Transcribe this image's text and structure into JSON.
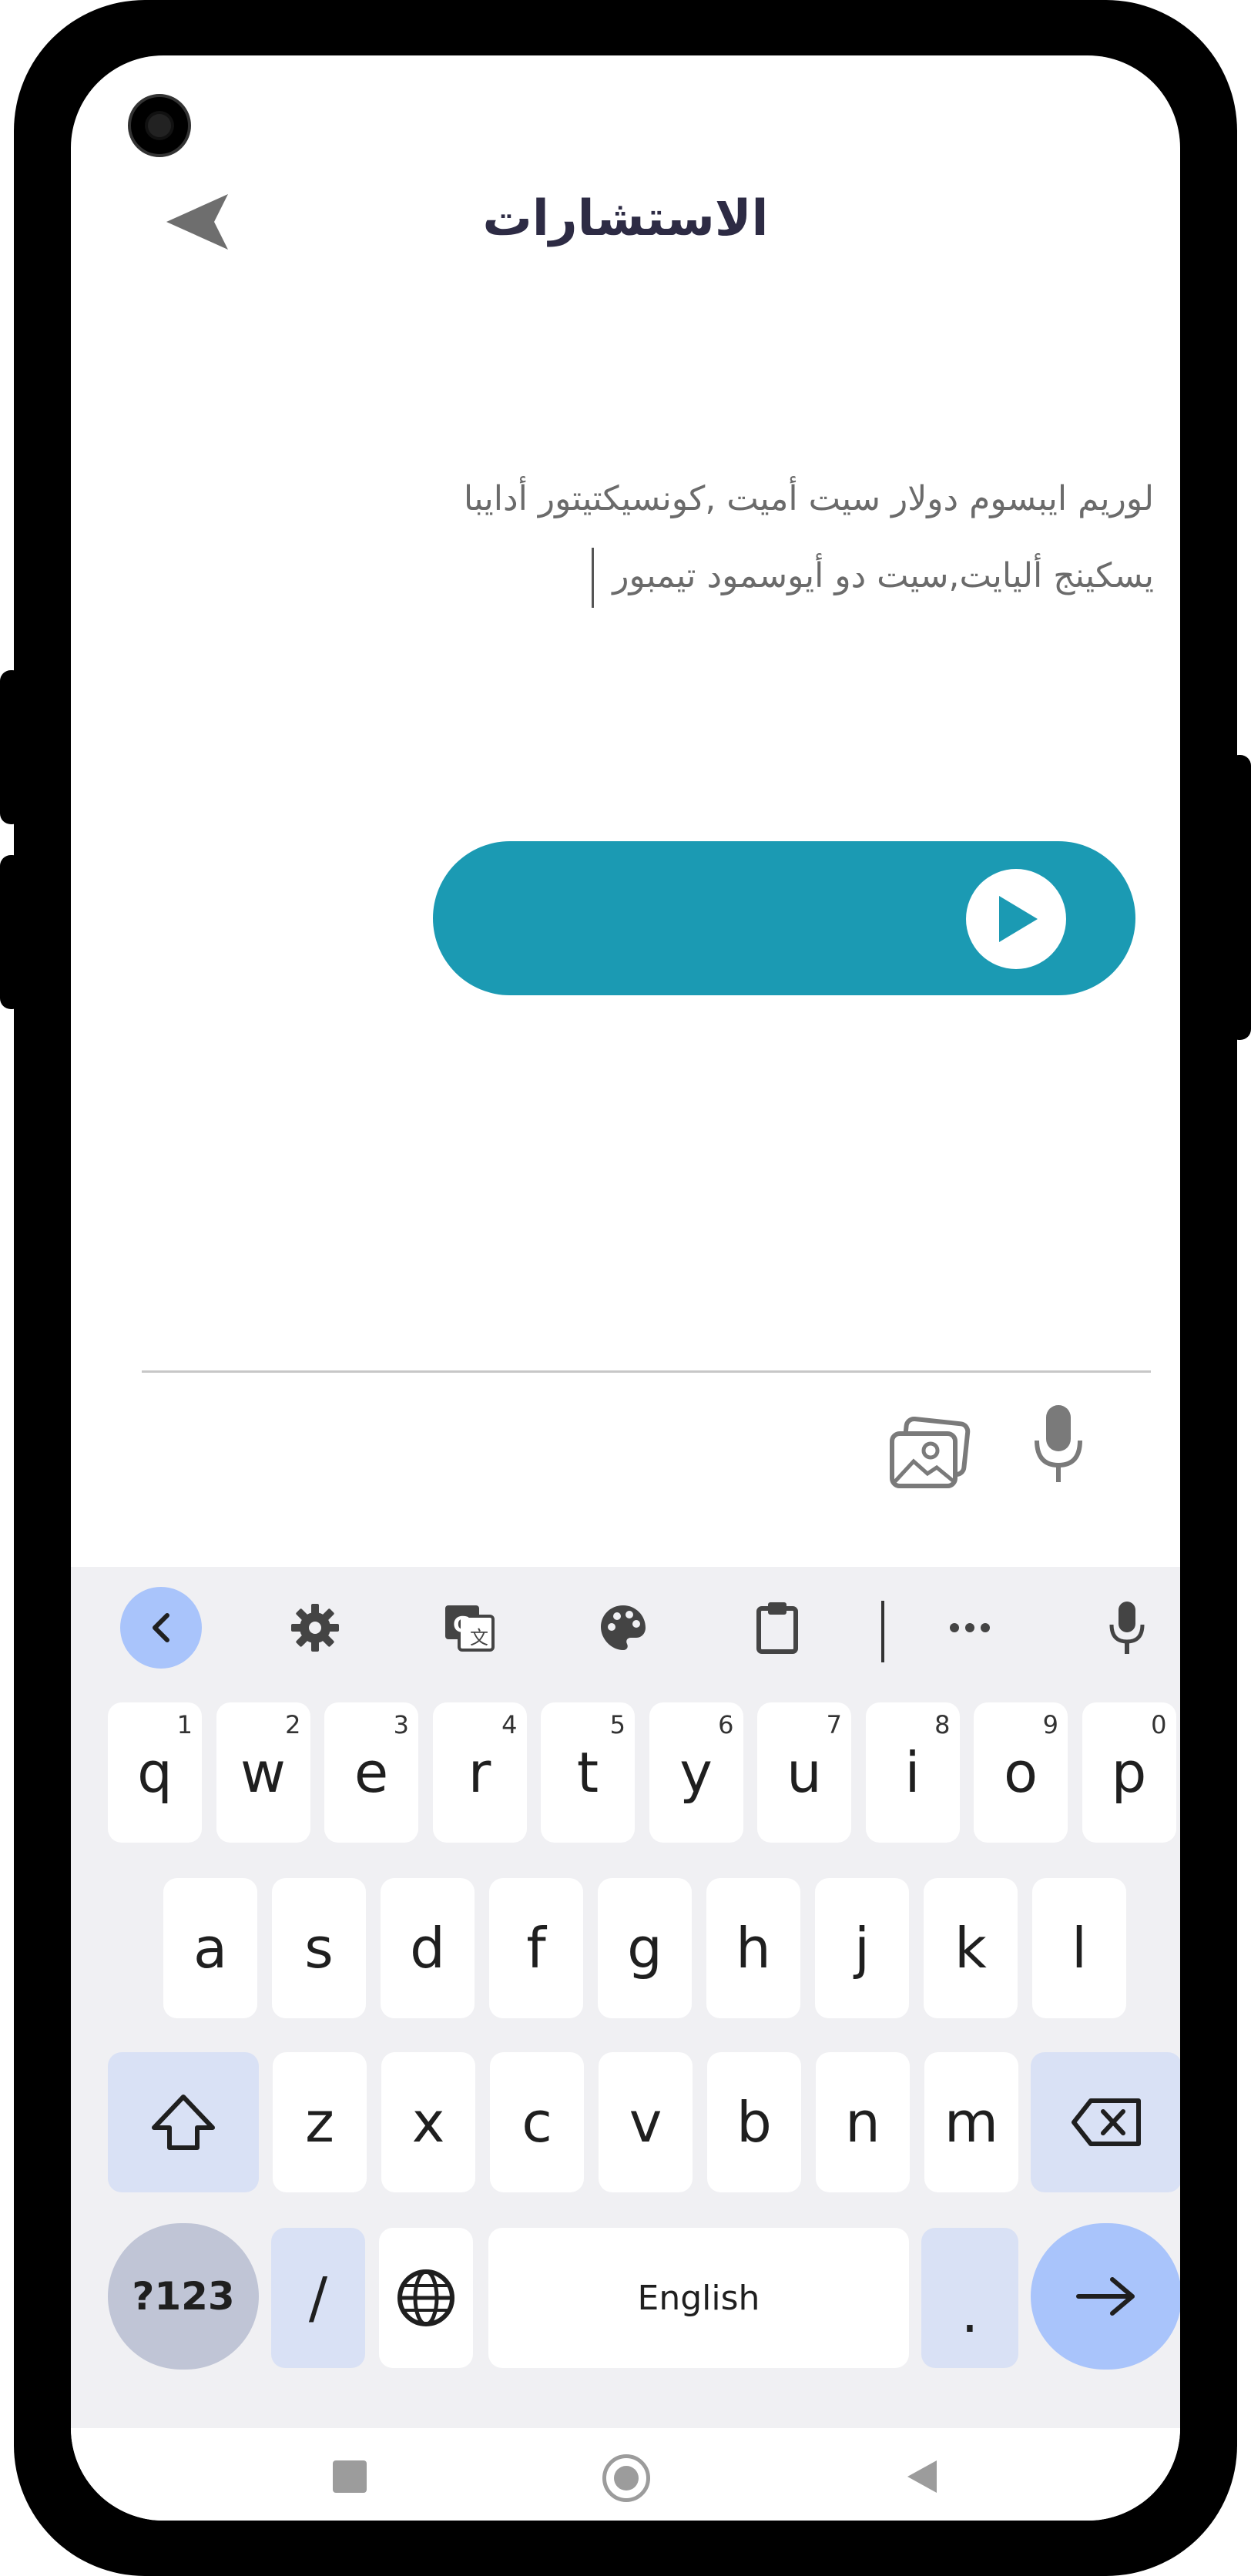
{
  "header": {
    "title": "الاستشارات"
  },
  "message": {
    "line1": "لوريم ايبسوم دولار سيت أميت ,كونسيكتيتور أدايبا",
    "line2": "يسكينج أليايت,سيت دو أيوسمود تيمبور"
  },
  "colors": {
    "accent": "#1b9ab3",
    "title": "#2d2b44",
    "kb_blue": "#a9c4fb"
  },
  "keyboard": {
    "row1": [
      {
        "k": "q",
        "n": "1"
      },
      {
        "k": "w",
        "n": "2"
      },
      {
        "k": "e",
        "n": "3"
      },
      {
        "k": "r",
        "n": "4"
      },
      {
        "k": "t",
        "n": "5"
      },
      {
        "k": "y",
        "n": "6"
      },
      {
        "k": "u",
        "n": "7"
      },
      {
        "k": "i",
        "n": "8"
      },
      {
        "k": "o",
        "n": "9"
      },
      {
        "k": "p",
        "n": "0"
      }
    ],
    "row2": [
      "a",
      "s",
      "d",
      "f",
      "g",
      "h",
      "j",
      "k",
      "l"
    ],
    "row3": [
      "z",
      "x",
      "c",
      "v",
      "b",
      "n",
      "m"
    ],
    "symbols_label": "?123",
    "slash_label": "/",
    "space_label": "English",
    "period_label": "."
  },
  "icons": {
    "back": "send-arrow-icon",
    "play": "play-icon",
    "gallery": "gallery-icon",
    "mic": "microphone-icon",
    "toolbar": [
      "chevron-left-icon",
      "gear-icon",
      "translate-icon",
      "palette-icon",
      "clipboard-icon",
      "more-icon",
      "microphone-icon"
    ]
  }
}
